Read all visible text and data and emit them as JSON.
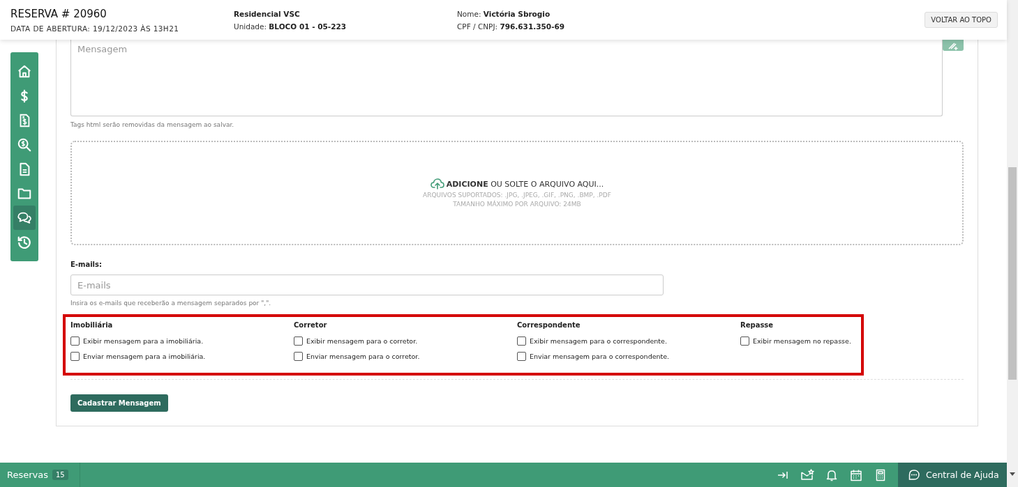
{
  "header": {
    "title": "RESERVA # 20960",
    "opened": "DATA DE ABERTURA: 19/12/2023 ÀS 13H21",
    "project": "Residencial VSC",
    "unit_label": "Unidade:",
    "unit": "BLOCO 01 - 05-223",
    "name_label": "Nome:",
    "name": "Victória Sbrogio",
    "doc_label": "CPF / CNPJ:",
    "doc": "796.631.350-69",
    "top_button": "VOLTAR AO TOPO"
  },
  "sidebar": {
    "items": [
      {
        "kind": "home",
        "selected": false
      },
      {
        "kind": "dollar",
        "selected": false
      },
      {
        "kind": "invoice",
        "selected": false
      },
      {
        "kind": "search-money",
        "selected": false
      },
      {
        "kind": "document",
        "selected": false
      },
      {
        "kind": "folder",
        "selected": false
      },
      {
        "kind": "chat",
        "selected": true
      },
      {
        "kind": "history",
        "selected": false
      }
    ]
  },
  "message": {
    "placeholder": "Mensagem",
    "hint": "Tags html serão removidas da mensagem ao salvar."
  },
  "upload": {
    "action": "**ADICIONE** OU SOLTE O ARQUIVO AQUI...",
    "formats": "ARQUIVOS SUPORTADOS: .JPG, .JPEG, .GIF, .PNG, .BMP, .PDF",
    "max_size": "TAMANHO MÁXIMO POR ARQUIVO: 24MB"
  },
  "emails": {
    "label": "E-mails:",
    "placeholder": "E-mails",
    "hint": "Insira os e-mails que receberão a mensagem separados por \",\"."
  },
  "groups": [
    {
      "title": "Imobiliária",
      "options": [
        {
          "label": "Exibir mensagem para a imobiliária.",
          "checked": false
        },
        {
          "label": "Enviar mensagem para a imobiliária.",
          "checked": false
        }
      ]
    },
    {
      "title": "Corretor",
      "options": [
        {
          "label": "Exibir mensagem para o corretor.",
          "checked": false
        },
        {
          "label": "Enviar mensagem para o corretor.",
          "checked": false
        }
      ]
    },
    {
      "title": "Correspondente",
      "options": [
        {
          "label": "Exibir mensagem para o correspondente.",
          "checked": false
        },
        {
          "label": "Enviar mensagem para o correspondente.",
          "checked": false
        }
      ]
    },
    {
      "title": "Repasse",
      "options": [
        {
          "label": "Exibir mensagem no repasse.",
          "checked": false
        }
      ]
    }
  ],
  "submit": "Cadastrar Mensagem",
  "footer": {
    "section": "Reservas",
    "count": "15",
    "help": "Central de Ajuda"
  }
}
